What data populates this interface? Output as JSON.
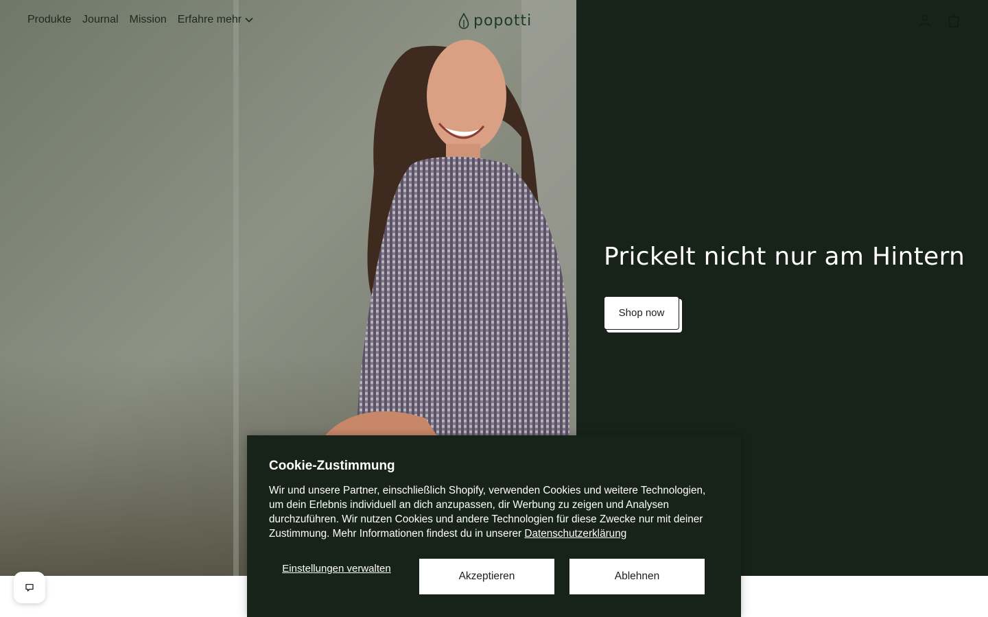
{
  "header": {
    "nav": [
      {
        "label": "Produkte"
      },
      {
        "label": "Journal"
      },
      {
        "label": "Mission"
      },
      {
        "label": "Erfahre mehr",
        "icon": "chevron-down-icon"
      }
    ],
    "logo_text": "popotti",
    "icons": [
      "account-icon",
      "cart-icon"
    ]
  },
  "hero": {
    "headline": "Prickelt nicht nur am Hintern",
    "cta_label": "Shop now",
    "panel_color": "#172218"
  },
  "cookie_banner": {
    "title": "Cookie-Zustimmung",
    "text": "Wir und unsere Partner, einschließlich Shopify, verwenden Cookies und weitere Technologien, um dein Erlebnis individuell an dich anzupassen, dir Werbung zu zeigen und Analysen durchzuführen. Wir nutzen Cookies und andere Technologien für diese Zwecke nur mit deiner Zustimmung. Mehr Informationen findest du in unserer ",
    "privacy_link": "Datenschutzerklärung",
    "settings_label": "Einstellungen verwalten",
    "accept_label": "Akzeptieren",
    "decline_label": "Ablehnen"
  },
  "chat": {
    "icon": "chat-icon"
  },
  "colors": {
    "brand_dark": "#172218",
    "logo": "#1b3a2a",
    "white": "#ffffff"
  }
}
